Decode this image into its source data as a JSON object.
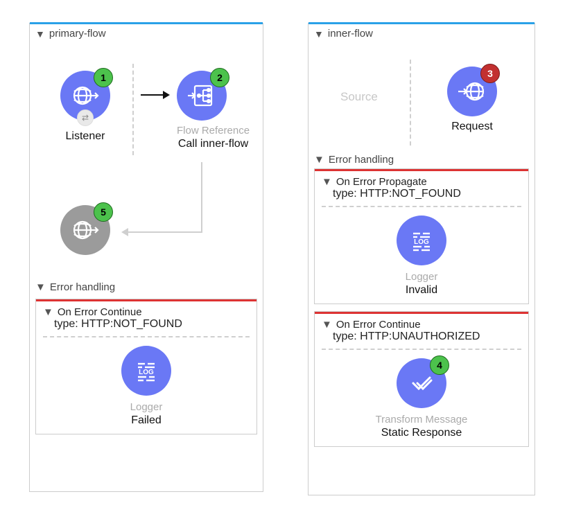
{
  "primary": {
    "title": "primary-flow",
    "listener": {
      "label": "Listener",
      "badge": "1"
    },
    "flowref": {
      "grey_label": "Flow Reference",
      "label": "Call inner-flow",
      "badge": "2"
    },
    "response": {
      "badge": "5"
    },
    "error_section": "Error handling",
    "on_error_continue": {
      "title": "On Error Continue",
      "type": "type: HTTP:NOT_FOUND",
      "logger_grey": "Logger",
      "logger_label": "Failed"
    }
  },
  "inner": {
    "title": "inner-flow",
    "source_placeholder": "Source",
    "request": {
      "label": "Request",
      "badge": "3"
    },
    "error_section": "Error handling",
    "on_error_propagate": {
      "title": "On Error Propagate",
      "type": "type: HTTP:NOT_FOUND",
      "logger_grey": "Logger",
      "logger_label": "Invalid"
    },
    "on_error_continue": {
      "title": "On Error Continue",
      "type": "type: HTTP:UNAUTHORIZED",
      "transform_grey": "Transform Message",
      "transform_label": "Static Response",
      "badge": "4"
    }
  }
}
